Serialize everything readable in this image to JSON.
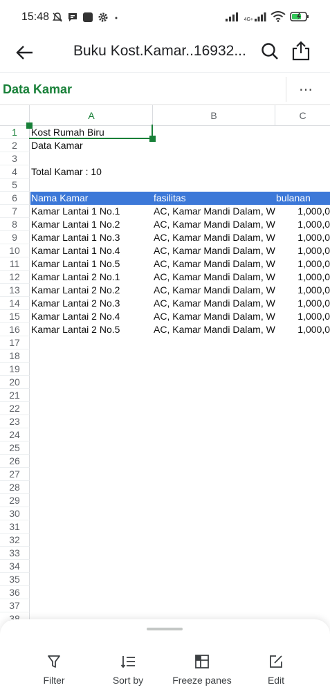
{
  "status_bar": {
    "time": "15:48",
    "left_icons": [
      "mute-icon",
      "message-icon",
      "app-icon",
      "settings-icon",
      "dot-icon"
    ],
    "right_icons": [
      "signal-icon",
      "network-4g-icon",
      "wifi-icon",
      "battery-icon"
    ],
    "network_label": "4G+"
  },
  "app_bar": {
    "title": "Buku Kost.Kamar..16932..."
  },
  "sheet_bar": {
    "sheet_name": "Data Kamar",
    "more_label": "⋯"
  },
  "colors": {
    "accent_green": "#188038",
    "header_row_blue": "#3c78d8"
  },
  "grid": {
    "columns": [
      "A",
      "B",
      "C"
    ],
    "selected_column": "A",
    "selected_cell": "A1",
    "row_numbers": [
      "1",
      "2",
      "3",
      "4",
      "5",
      "6",
      "7",
      "8",
      "9",
      "10",
      "11",
      "12",
      "13",
      "14",
      "15",
      "16",
      "17",
      "18",
      "19",
      "20",
      "21",
      "22",
      "23",
      "24",
      "25",
      "26",
      "27",
      "28",
      "29",
      "30",
      "31",
      "32",
      "33",
      "34",
      "35",
      "36",
      "37",
      "38"
    ],
    "rows": [
      {
        "a": "Kost Rumah Biru",
        "b": "",
        "c": ""
      },
      {
        "a": "Data Kamar",
        "b": "",
        "c": ""
      },
      {
        "a": "",
        "b": "",
        "c": ""
      },
      {
        "a": "Total Kamar : 10",
        "b": "",
        "c": ""
      },
      {
        "a": "",
        "b": "",
        "c": ""
      },
      {
        "a": "Nama Kamar",
        "b": "fasilitas",
        "c": "bulanan"
      },
      {
        "a": "Kamar Lantai 1 No.1",
        "b": "AC, Kamar Mandi Dalam, W",
        "c": "1,000,0"
      },
      {
        "a": "Kamar Lantai 1 No.2",
        "b": "AC, Kamar Mandi Dalam, W",
        "c": "1,000,0"
      },
      {
        "a": "Kamar Lantai 1 No.3",
        "b": "AC, Kamar Mandi Dalam, W",
        "c": "1,000,0"
      },
      {
        "a": "Kamar Lantai 1 No.4",
        "b": "AC, Kamar Mandi Dalam, W",
        "c": "1,000,0"
      },
      {
        "a": "Kamar Lantai 1 No.5",
        "b": "AC, Kamar Mandi Dalam, W",
        "c": "1,000,0"
      },
      {
        "a": "Kamar Lantai 2 No.1",
        "b": "AC, Kamar Mandi Dalam, W",
        "c": "1,000,0"
      },
      {
        "a": "Kamar Lantai 2 No.2",
        "b": "AC, Kamar Mandi Dalam, W",
        "c": "1,000,0"
      },
      {
        "a": "Kamar Lantai 2 No.3",
        "b": "AC, Kamar Mandi Dalam, W",
        "c": "1,000,0"
      },
      {
        "a": "Kamar Lantai 2 No.4",
        "b": "AC, Kamar Mandi Dalam, W",
        "c": "1,000,0"
      },
      {
        "a": "Kamar Lantai 2 No.5",
        "b": "AC, Kamar Mandi Dalam, W",
        "c": "1,000,0"
      }
    ]
  },
  "bottom_sheet": {
    "actions": [
      {
        "label": "Filter",
        "icon": "filter-icon"
      },
      {
        "label": "Sort by",
        "icon": "sort-icon"
      },
      {
        "label": "Freeze panes",
        "icon": "freeze-panes-icon"
      },
      {
        "label": "Edit",
        "icon": "edit-icon"
      }
    ]
  }
}
